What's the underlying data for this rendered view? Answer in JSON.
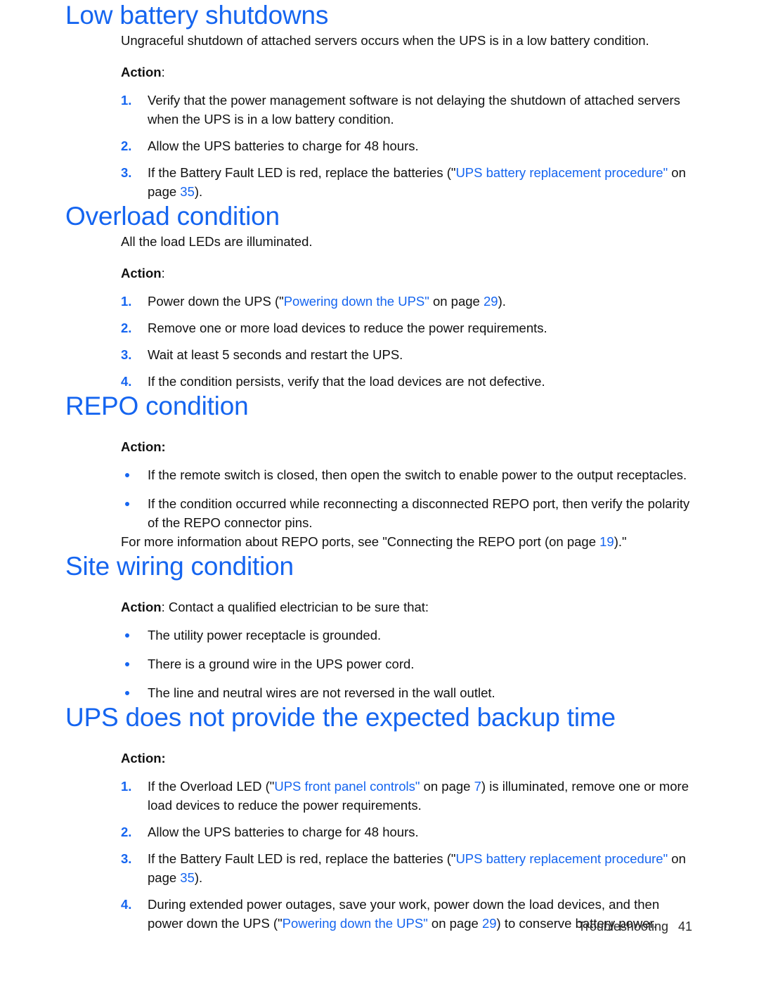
{
  "colors": {
    "heading_blue": "#1565f0",
    "link_blue": "#1565f0",
    "body_text": "#111111",
    "page_background": "#ffffff"
  },
  "sections": [
    {
      "id": "low-battery-shutdowns",
      "heading": "Low battery shutdowns",
      "intro": "Ungraceful shutdown of attached servers occurs when the UPS is in a low battery condition.",
      "action_label": "Action",
      "action_colon": ":",
      "list_type": "numbered",
      "items": [
        {
          "marker": "1.",
          "parts": [
            {
              "text": "Verify that the power management software is not delaying the shutdown of attached servers when the UPS is in a low battery condition.",
              "style": "plain"
            }
          ]
        },
        {
          "marker": "2.",
          "parts": [
            {
              "text": "Allow the UPS batteries to charge for 48 hours.",
              "style": "plain"
            }
          ]
        },
        {
          "marker": "3.",
          "parts": [
            {
              "text": "If the Battery Fault LED is red, replace the batteries (\"",
              "style": "plain"
            },
            {
              "text": "UPS battery replacement procedure",
              "style": "link"
            },
            {
              "text": "\"",
              "style": "quote-blue"
            },
            {
              "text": " on page ",
              "style": "plain"
            },
            {
              "text": "35",
              "style": "page-ref"
            },
            {
              "text": ").",
              "style": "plain"
            }
          ]
        }
      ]
    },
    {
      "id": "overload-condition",
      "heading": "Overload condition",
      "intro": "All the load LEDs are illuminated.",
      "action_label": "Action",
      "action_colon": ":",
      "list_type": "numbered",
      "items": [
        {
          "marker": "1.",
          "parts": [
            {
              "text": "Power down the UPS (\"",
              "style": "plain"
            },
            {
              "text": "Powering down the UPS",
              "style": "link"
            },
            {
              "text": "\"",
              "style": "quote-blue"
            },
            {
              "text": " on page ",
              "style": "plain"
            },
            {
              "text": "29",
              "style": "page-ref"
            },
            {
              "text": ").",
              "style": "plain"
            }
          ]
        },
        {
          "marker": "2.",
          "parts": [
            {
              "text": "Remove one or more load devices to reduce the power requirements.",
              "style": "plain"
            }
          ]
        },
        {
          "marker": "3.",
          "parts": [
            {
              "text": "Wait at least 5 seconds and restart the UPS.",
              "style": "plain"
            }
          ]
        },
        {
          "marker": "4.",
          "parts": [
            {
              "text": "If the condition persists, verify that the load devices are not defective.",
              "style": "plain"
            }
          ]
        }
      ]
    },
    {
      "id": "repo-condition",
      "heading": "REPO condition",
      "intro": null,
      "action_label": "Action:",
      "action_colon": "",
      "list_type": "bulleted",
      "items": [
        {
          "marker": "•",
          "parts": [
            {
              "text": "If the remote switch is closed, then open the switch to enable power to the output receptacles.",
              "style": "plain"
            }
          ]
        },
        {
          "marker": "•",
          "parts": [
            {
              "text": "If the condition occurred while reconnecting a disconnected REPO port, then verify the polarity of the REPO connector pins.",
              "style": "plain"
            }
          ]
        }
      ],
      "outro_parts": [
        {
          "text": "For more information about REPO ports, see \"Connecting the REPO port (on page ",
          "style": "plain"
        },
        {
          "text": "19",
          "style": "page-ref"
        },
        {
          "text": ").\"",
          "style": "plain"
        }
      ]
    },
    {
      "id": "site-wiring-condition",
      "heading": "Site wiring condition",
      "intro": null,
      "action_label": "Action",
      "action_colon": ":",
      "action_inline_text": " Contact a qualified electrician to be sure that:",
      "list_type": "bulleted",
      "items": [
        {
          "marker": "•",
          "parts": [
            {
              "text": "The utility power receptacle is grounded.",
              "style": "plain"
            }
          ]
        },
        {
          "marker": "•",
          "parts": [
            {
              "text": "There is a ground wire in the UPS power cord.",
              "style": "plain"
            }
          ]
        },
        {
          "marker": "•",
          "parts": [
            {
              "text": "The line and neutral wires are not reversed in the wall outlet.",
              "style": "plain"
            }
          ]
        }
      ]
    },
    {
      "id": "ups-backup-time",
      "heading": "UPS does not provide the expected backup time",
      "intro": null,
      "action_label": "Action:",
      "action_colon": "",
      "list_type": "numbered",
      "items": [
        {
          "marker": "1.",
          "parts": [
            {
              "text": "If the Overload LED (\"",
              "style": "plain"
            },
            {
              "text": "UPS front panel controls",
              "style": "link"
            },
            {
              "text": "\"",
              "style": "quote-blue"
            },
            {
              "text": " on page ",
              "style": "plain"
            },
            {
              "text": "7",
              "style": "page-ref"
            },
            {
              "text": ") is illuminated, remove one or more load devices to reduce the power requirements.",
              "style": "plain"
            }
          ]
        },
        {
          "marker": "2.",
          "parts": [
            {
              "text": "Allow the UPS batteries to charge for 48 hours.",
              "style": "plain"
            }
          ]
        },
        {
          "marker": "3.",
          "parts": [
            {
              "text": "If the Battery Fault LED is red, replace the batteries (\"",
              "style": "plain"
            },
            {
              "text": "UPS battery replacement procedure",
              "style": "link"
            },
            {
              "text": "\"",
              "style": "quote-blue"
            },
            {
              "text": " on page ",
              "style": "plain"
            },
            {
              "text": "35",
              "style": "page-ref"
            },
            {
              "text": ").",
              "style": "plain"
            }
          ]
        },
        {
          "marker": "4.",
          "parts": [
            {
              "text": "During extended power outages, save your work, power down the load devices, and then power down the UPS (\"",
              "style": "plain"
            },
            {
              "text": "Powering down the UPS",
              "style": "link"
            },
            {
              "text": "\"",
              "style": "quote-blue"
            },
            {
              "text": " on page ",
              "style": "plain"
            },
            {
              "text": "29",
              "style": "page-ref"
            },
            {
              "text": ") to conserve battery power.",
              "style": "plain"
            }
          ]
        }
      ]
    }
  ],
  "footer": {
    "chapter": "Troubleshooting",
    "page_number": "41"
  }
}
